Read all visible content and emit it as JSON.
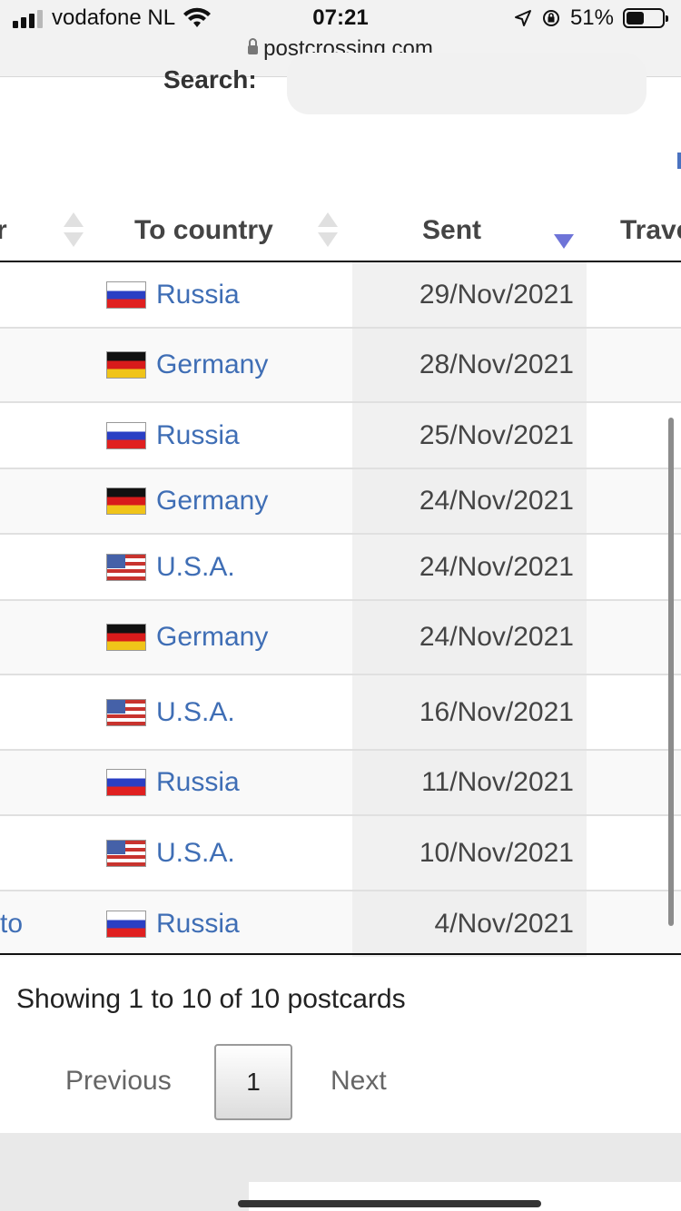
{
  "status": {
    "carrier": "vodafone NL",
    "time": "07:21",
    "battery": "51%",
    "battery_level": 0.51,
    "url": "postcrossing.com"
  },
  "search": {
    "label": "Search:",
    "value": "",
    "placeholder": ""
  },
  "table": {
    "columns": {
      "from_partial": "r",
      "to_country": "To country",
      "sent": "Sent",
      "traveled_partial": "Trave"
    },
    "rows": [
      {
        "from": "",
        "country": "Russia",
        "flag": "ru",
        "sent": "29/Nov/2021"
      },
      {
        "from": "",
        "country": "Germany",
        "flag": "de",
        "sent": "28/Nov/2021"
      },
      {
        "from": "",
        "country": "Russia",
        "flag": "ru",
        "sent": "25/Nov/2021"
      },
      {
        "from": "",
        "country": "Germany",
        "flag": "de",
        "sent": "24/Nov/2021"
      },
      {
        "from": "",
        "country": "U.S.A.",
        "flag": "us",
        "sent": "24/Nov/2021"
      },
      {
        "from": "",
        "country": "Germany",
        "flag": "de",
        "sent": "24/Nov/2021"
      },
      {
        "from": "",
        "country": "U.S.A.",
        "flag": "us",
        "sent": "16/Nov/2021"
      },
      {
        "from": "",
        "country": "Russia",
        "flag": "ru",
        "sent": "11/Nov/2021"
      },
      {
        "from": "",
        "country": "U.S.A.",
        "flag": "us",
        "sent": "10/Nov/2021"
      },
      {
        "from": "to",
        "country": "Russia",
        "flag": "ru",
        "sent": "4/Nov/2021"
      }
    ]
  },
  "info": "Showing 1 to 10 of 10 postcards",
  "pagination": {
    "previous": "Previous",
    "page": "1",
    "next": "Next"
  },
  "colors": {
    "link": "#3f6eb5",
    "sort_active": "#6e74d8"
  }
}
